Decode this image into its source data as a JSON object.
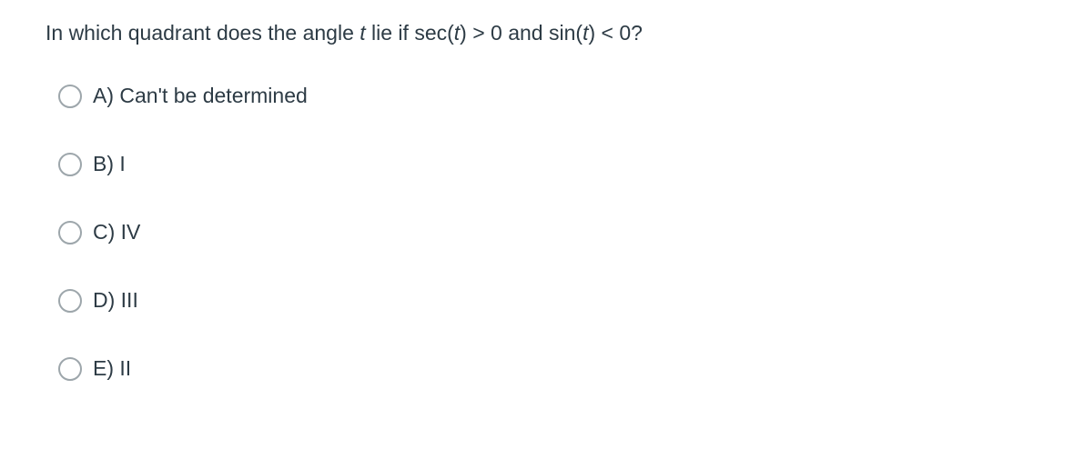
{
  "question": {
    "prefix": "In which quadrant does the angle ",
    "variable1": "t",
    "mid1": " lie if sec(",
    "variable2": "t",
    "mid2": ") > 0 and sin(",
    "variable3": "t",
    "suffix": ") < 0?"
  },
  "options": [
    {
      "label": "A) Can't be determined"
    },
    {
      "label": "B) I"
    },
    {
      "label": "C) IV"
    },
    {
      "label": "D) III"
    },
    {
      "label": "E) II"
    }
  ]
}
